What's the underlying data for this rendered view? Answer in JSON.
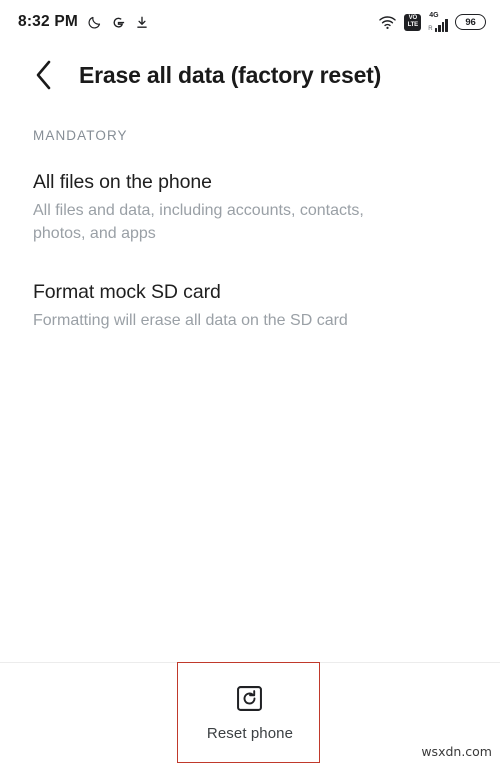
{
  "status_bar": {
    "time": "8:32 PM",
    "left_icons": [
      {
        "name": "moon-icon",
        "label": "Do not disturb"
      },
      {
        "name": "google-icon",
        "label": "G"
      },
      {
        "name": "download-icon",
        "label": "Download"
      }
    ],
    "wifi_icon": "wifi-icon",
    "volte_top": "VO",
    "volte_bottom": "LTE",
    "network_type": "4G",
    "signal_roaming": "R",
    "battery_percent": "96"
  },
  "app_bar": {
    "back_icon": "back-chevron-icon",
    "title": "Erase all data (factory reset)"
  },
  "content": {
    "section_label": "MANDATORY",
    "items": [
      {
        "title": "All files on the phone",
        "subtitle": "All files and data, including accounts, contacts, photos, and apps"
      },
      {
        "title": "Format mock SD card",
        "subtitle": "Formatting will erase all data on the SD card"
      }
    ]
  },
  "bottom_bar": {
    "reset_icon": "reset-phone-icon",
    "reset_label": "Reset phone"
  },
  "annotation": {
    "highlight_color": "#c0392b"
  },
  "watermark": "wsxdn.com"
}
